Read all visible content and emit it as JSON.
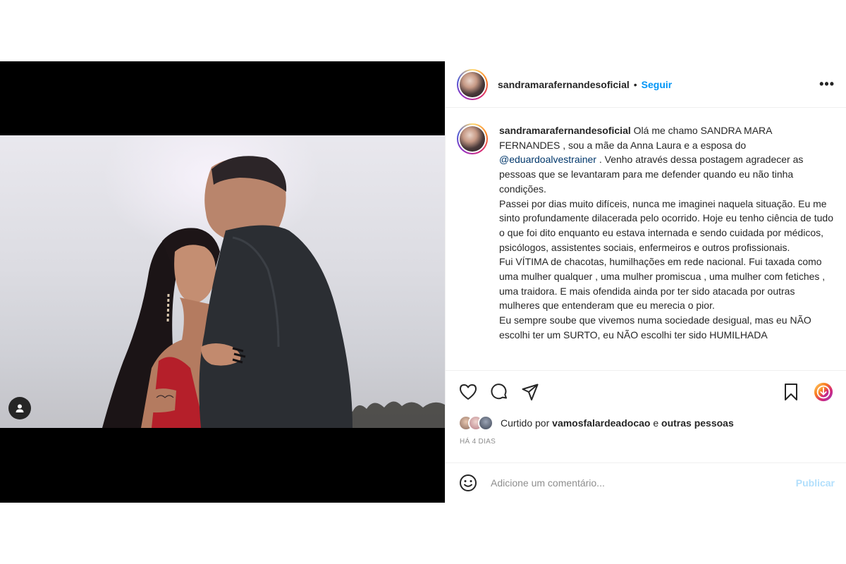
{
  "post": {
    "username": "sandramarafernandesoficial",
    "separator": "•",
    "follow_label": "Seguir",
    "more_label": "•••",
    "caption_username": "sandramarafernandesoficial",
    "caption_line1_pre": "Olá me chamo SANDRA MARA FERNANDES , sou a mãe da Anna Laura e a esposa do ",
    "caption_mention": "@eduardoalvestrainer",
    "caption_line1_post": " . Venho através dessa postagem agradecer as pessoas que se levantaram para me defender quando eu não tinha condições.",
    "caption_p2": "Passei por dias muito difíceis, nunca me imaginei naquela situação. Eu me sinto profundamente dilacerada pelo ocorrido. Hoje eu tenho ciência de tudo o que foi dito enquanto eu estava internada e sendo cuidada por médicos, psicólogos, assistentes sociais, enfermeiros e outros profissionais.",
    "caption_p3": "Fui VÍTIMA de chacotas, humilhações em rede nacional. Fui taxada como uma mulher qualquer , uma mulher promiscua , uma mulher com fetiches , uma traidora. E mais ofendida ainda por ter sido atacada por outras mulheres que entenderam que eu merecia o pior.",
    "caption_p4": "Eu sempre soube que vivemos numa sociedade desigual, mas eu NÃO escolhi ter um SURTO, eu NÃO escolhi ter sido HUMILHADA",
    "liked_by_prefix": "Curtido por ",
    "liked_by_user": "vamosfalardeadocao",
    "liked_by_join": " e ",
    "liked_by_others": "outras pessoas",
    "date": "HÁ 4 DIAS"
  },
  "comment": {
    "placeholder": "Adicione um comentário...",
    "publish_label": "Publicar"
  },
  "colors": {
    "link_blue": "#0095f6",
    "publish_disabled": "#b2dffc",
    "mention": "#00376b"
  },
  "icons": [
    "tag-user-icon",
    "heart-icon",
    "comment-icon",
    "share-icon",
    "bookmark-icon",
    "download-icon",
    "emoji-icon",
    "more-icon"
  ]
}
